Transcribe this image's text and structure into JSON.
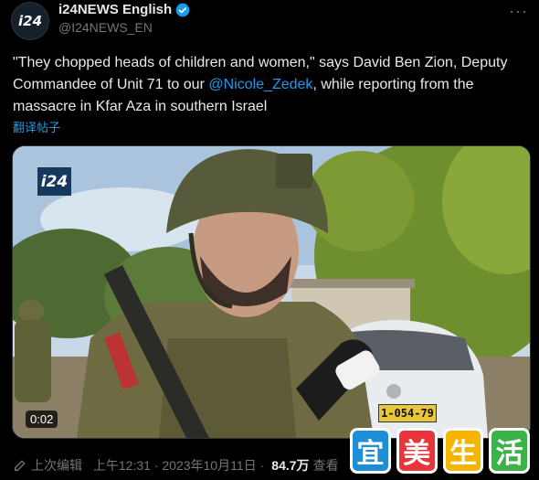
{
  "account": {
    "avatar_text": "i24",
    "display_name": "i24NEWS English",
    "handle": "@I24NEWS_EN",
    "more_icon": "more-icon",
    "verified_color": "#1d9bf0"
  },
  "tweet": {
    "text_part1": "\"They chopped heads of children and women,\" says David Ben Zion, Deputy Commandee of Unit 71 to our ",
    "mention": "@Nicole_Zedek",
    "text_part2": ", while reporting from the massacre in Kfar Aza in southern Israel",
    "translate_link": "翻译帖子"
  },
  "video": {
    "channel_logo": "i24",
    "time": "0:02",
    "plate_text": "1-054-79"
  },
  "footer": {
    "edited_label": "上次编辑",
    "timestamp": "上午12:31 · 2023年10月11日",
    "views_count": "84.7万",
    "views_label": "查看"
  },
  "watermark": {
    "chars": [
      "宜",
      "美",
      "生",
      "活"
    ],
    "colors": [
      "#1e8fd6",
      "#e8343b",
      "#f5b400",
      "#3bb34a"
    ]
  }
}
